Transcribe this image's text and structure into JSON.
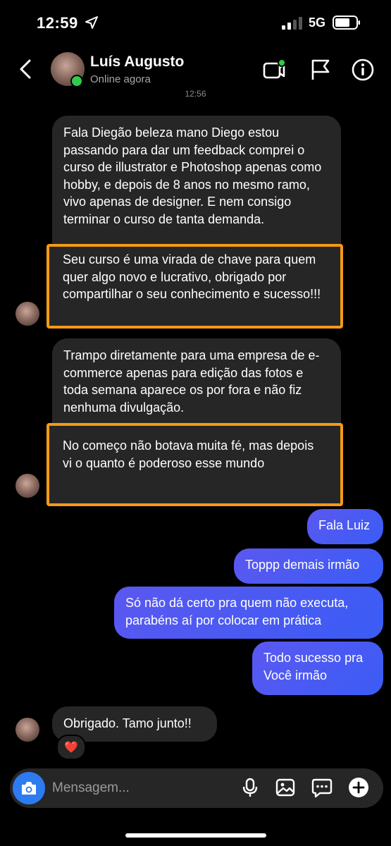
{
  "status_bar": {
    "time": "12:59",
    "network": "5G"
  },
  "header": {
    "name": "Luís Augusto",
    "status": "Online agora"
  },
  "timestamp": "12:56",
  "messages": {
    "m1": {
      "text": "Fala Diegão beleza mano Diego estou passando para dar um feedback comprei o curso de illustrator e Photoshop apenas como hobby, e depois de 8 anos no mesmo ramo, vivo apenas de designer. E nem consigo terminar o curso de tanta demanda."
    },
    "m2": {
      "text": "Seu curso é uma virada de chave para quem quer algo novo e lucrativo, obrigado por compartilhar o seu conhecimento e sucesso!!!"
    },
    "m3": {
      "text": "Trampo diretamente para uma empresa de e-commerce apenas para edição das fotos e toda semana aparece os por fora e não fiz nenhuma divulgação."
    },
    "m4": {
      "text": "No começo não botava muita fé, mas depois vi o quanto é poderoso esse mundo"
    },
    "m5": {
      "text": "Fala Luiz"
    },
    "m6": {
      "text": "Toppp demais irmão"
    },
    "m7": {
      "text": "Só não dá certo pra quem não executa, parabéns aí por colocar em prática"
    },
    "m8": {
      "text": "Todo sucesso pra Você irmão"
    },
    "m9": {
      "text": "Obrigado. Tamo junto!!"
    }
  },
  "reaction": "❤️",
  "composer": {
    "placeholder": "Mensagem..."
  },
  "icons": [
    "location-arrow-icon",
    "signal-icon",
    "battery-icon",
    "back-icon",
    "video-call-icon",
    "flag-icon",
    "info-icon",
    "camera-icon",
    "microphone-icon",
    "gallery-icon",
    "sticker-icon",
    "plus-icon"
  ],
  "colors": {
    "outgoing_bubble": "#4a5af2",
    "incoming_bubble": "#262626",
    "highlight": "#f59a14",
    "online": "#2fcc4a",
    "camera_button": "#2d7bf1"
  }
}
